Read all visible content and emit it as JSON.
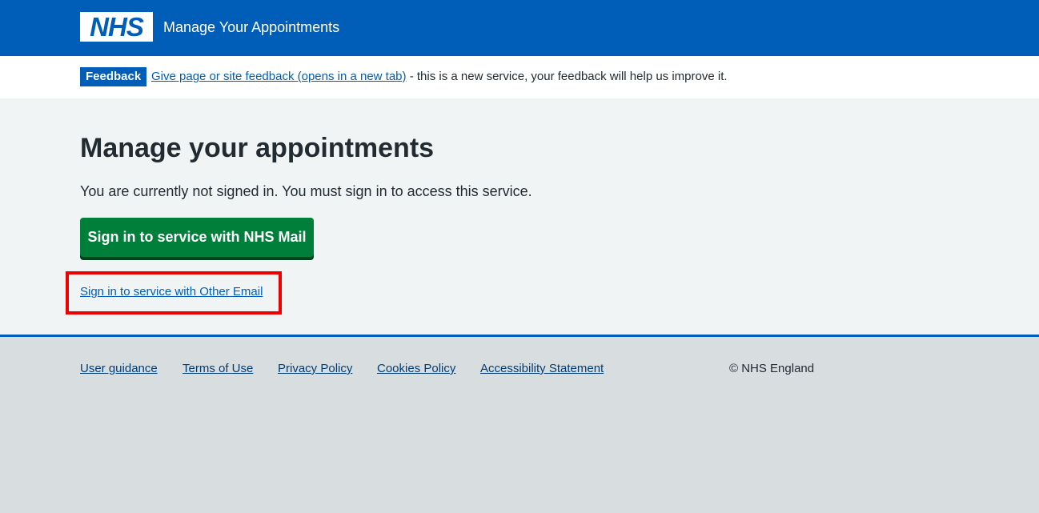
{
  "header": {
    "logo_text": "NHS",
    "service_name": "Manage Your Appointments"
  },
  "feedback": {
    "tag": "Feedback",
    "link_text": "Give page or site feedback (opens in a new tab)",
    "trailing_text": " - this is a new service, your feedback will help us improve it."
  },
  "main": {
    "title": "Manage your appointments",
    "lead": "You are currently not signed in. You must sign in to access this service.",
    "primary_button": "Sign in to service with NHS Mail",
    "other_email_link": "Sign in to service with Other Email"
  },
  "footer": {
    "links": [
      "User guidance",
      "Terms of Use",
      "Privacy Policy",
      "Cookies Policy",
      "Accessibility Statement"
    ],
    "copyright": "© NHS England"
  },
  "colors": {
    "nhs_blue": "#005eb8",
    "nhs_green": "#007f3b",
    "highlight_red": "#ee0000",
    "page_background": "#f0f4f5",
    "footer_background": "#d8dde0"
  }
}
